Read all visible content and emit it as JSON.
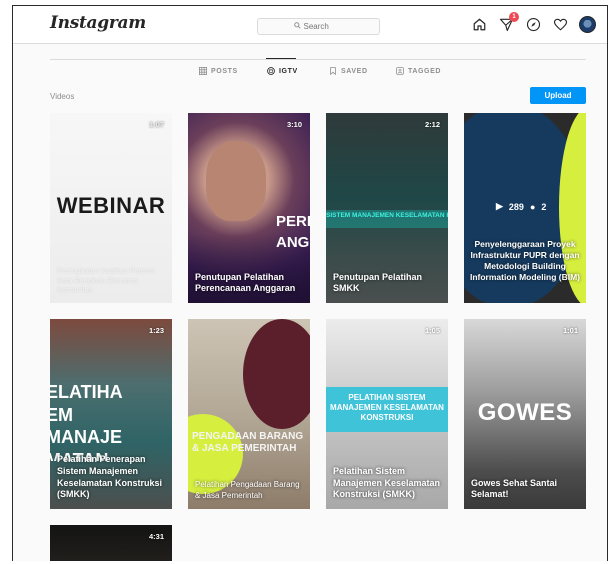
{
  "header": {
    "logo": "Instagram",
    "search_placeholder": "Search",
    "notification_count": "1"
  },
  "tabs": [
    {
      "label": "POSTS",
      "icon": "grid-icon",
      "active": false
    },
    {
      "label": "IGTV",
      "icon": "igtv-icon",
      "active": true
    },
    {
      "label": "SAVED",
      "icon": "bookmark-icon",
      "active": false
    },
    {
      "label": "TAGGED",
      "icon": "tag-icon",
      "active": false
    }
  ],
  "section": {
    "title": "Videos",
    "upload_label": "Upload"
  },
  "videos": [
    {
      "duration": "1:07",
      "caption": "Peningkatan Kualitas Potensi Kota Bengkulu Bersama Komunitas",
      "overlay": "WEBINAR"
    },
    {
      "duration": "3:10",
      "caption": "Penutupan Pelatihan Perencanaan Anggaran",
      "overlay": "PERE ANG"
    },
    {
      "duration": "2:12",
      "caption": "Penutupan Pelatihan SMKK",
      "overlay": "SISTEM MANAJEMEN KESELAMATAN KONSTRUKSI"
    },
    {
      "duration": "",
      "caption": "Penyelenggaraan Proyek Infrastruktur PUPR dengan Metodologi Building Information Modeling (BIM)",
      "overlay": "",
      "likes": "289",
      "comments": "2"
    },
    {
      "duration": "1:23",
      "caption": "Pelatihan Penerapan Sistem Manajemen Keselamatan Konstruksi (SMKK)",
      "overlay": "ELATIHA EM MANAJE MATAN KON"
    },
    {
      "duration": "",
      "caption": "Pelatihan Pengadaan Barang & Jasa Pemerintah",
      "overlay": "PENGADAAN BARANG & JASA PEMERINTAH"
    },
    {
      "duration": "1:05",
      "caption": "Pelatihan Sistem Manajemen Keselamatan Konstruksi (SMKK)",
      "overlay": "PELATIHAN SISTEM MANAJEMEN KESELAMATAN KONSTRUKSI"
    },
    {
      "duration": "1:01",
      "caption": "Gowes Sehat Santai Selamat!",
      "overlay": "GOWES"
    },
    {
      "duration": "4:31",
      "caption": "",
      "overlay": ""
    }
  ],
  "colors": {
    "accent": "#0095f6",
    "badge": "#ed4956",
    "lime": "#d6ef3f"
  }
}
